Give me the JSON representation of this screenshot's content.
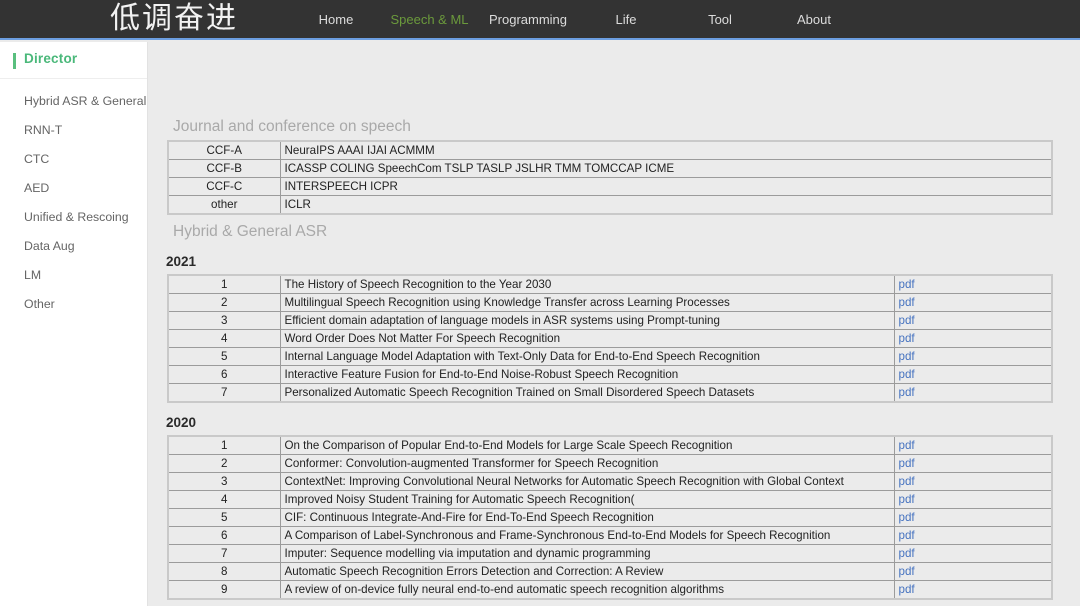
{
  "navbar": {
    "brand": "低调奋进",
    "links": [
      {
        "label": "Home",
        "active": false
      },
      {
        "label": "Speech & ML",
        "active": true
      },
      {
        "label": "Programming",
        "active": false
      },
      {
        "label": "Life",
        "active": false
      },
      {
        "label": "Tool",
        "active": false
      },
      {
        "label": "About",
        "active": false
      }
    ],
    "active_color": "#6b9a3c",
    "background": "#333333",
    "underline_color": "#6c9ee0"
  },
  "sidebar": {
    "header": "Director",
    "header_color": "#4ab87a",
    "items": [
      {
        "label": "Hybrid ASR & General"
      },
      {
        "label": "RNN-T"
      },
      {
        "label": "CTC"
      },
      {
        "label": "AED"
      },
      {
        "label": "Unified & Rescoing"
      },
      {
        "label": "Data Aug"
      },
      {
        "label": "LM"
      },
      {
        "label": "Other"
      }
    ]
  },
  "content": {
    "journal_section_title": "Journal and conference on speech",
    "journal_table": {
      "rows": [
        {
          "rank": "CCF-A",
          "venues": "NeuraIPS  AAAI  IJAI  ACMMM"
        },
        {
          "rank": "CCF-B",
          "venues": "ICASSP  COLING  SpeechCom  TSLP  TASLP  JSLHR  TMM  TOMCCAP  ICME"
        },
        {
          "rank": "CCF-C",
          "venues": "INTERSPEECH  ICPR"
        },
        {
          "rank": "other",
          "venues": "ICLR"
        }
      ]
    },
    "asr_section_title": "Hybrid & General ASR",
    "link_label": "pdf",
    "years": [
      {
        "year": "2021",
        "papers": [
          {
            "n": "1",
            "title": "The History of Speech Recognition to the Year 2030",
            "link": "pdf"
          },
          {
            "n": "2",
            "title": "Multilingual Speech Recognition using Knowledge Transfer across Learning Processes",
            "link": "pdf"
          },
          {
            "n": "3",
            "title": "Efficient domain adaptation of language models in ASR systems using Prompt-tuning",
            "link": "pdf"
          },
          {
            "n": "4",
            "title": "Word Order Does Not Matter For Speech Recognition",
            "link": "pdf"
          },
          {
            "n": "5",
            "title": "Internal Language Model Adaptation with Text-Only Data for End-to-End Speech Recognition",
            "link": "pdf"
          },
          {
            "n": "6",
            "title": "Interactive Feature Fusion for End-to-End Noise-Robust Speech Recognition",
            "link": "pdf"
          },
          {
            "n": "7",
            "title": "Personalized Automatic Speech Recognition Trained on Small Disordered Speech Datasets",
            "link": "pdf"
          }
        ]
      },
      {
        "year": "2020",
        "papers": [
          {
            "n": "1",
            "title": "On the Comparison of Popular End-to-End Models for Large Scale Speech Recognition",
            "link": "pdf"
          },
          {
            "n": "2",
            "title": "Conformer: Convolution-augmented Transformer for Speech Recognition",
            "link": "pdf"
          },
          {
            "n": "3",
            "title": "ContextNet: Improving Convolutional Neural Networks for Automatic Speech Recognition with Global Context",
            "link": "pdf"
          },
          {
            "n": "4",
            "title": "Improved Noisy Student Training for Automatic Speech Recognition(",
            "link": "pdf"
          },
          {
            "n": "5",
            "title": "CIF: Continuous Integrate-And-Fire for End-To-End Speech Recognition",
            "link": "pdf"
          },
          {
            "n": "6",
            "title": "A Comparison of Label-Synchronous and Frame-Synchronous End-to-End Models for Speech Recognition",
            "link": "pdf"
          },
          {
            "n": "7",
            "title": "Imputer: Sequence modelling via imputation and dynamic programming",
            "link": "pdf"
          },
          {
            "n": "8",
            "title": "Automatic Speech Recognition Errors Detection and Correction: A Review",
            "link": "pdf"
          },
          {
            "n": "9",
            "title": "A review of on-device fully neural end-to-end automatic speech recognition algorithms",
            "link": "pdf"
          }
        ]
      }
    ]
  }
}
